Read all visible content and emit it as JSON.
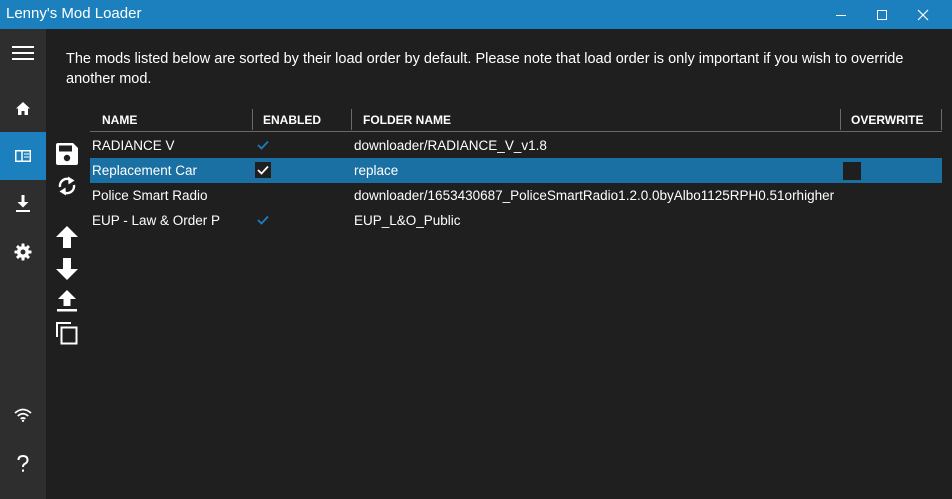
{
  "window": {
    "title": "Lenny's Mod Loader"
  },
  "sidebar": {
    "items": [
      {
        "icon": "hamburger-menu-icon"
      },
      {
        "icon": "home-icon"
      },
      {
        "icon": "mods-list-icon",
        "active": true
      },
      {
        "icon": "download-icon"
      },
      {
        "icon": "gear-icon"
      },
      {
        "icon": "wifi-icon"
      },
      {
        "icon": "help-icon"
      }
    ]
  },
  "intro": {
    "text": "The mods listed below are sorted by their load order by default. Please note that load order is only important if you wish to override another mod."
  },
  "toolbar": {
    "icons": [
      "save-icon",
      "refresh-icon",
      "move-up-icon",
      "move-down-icon",
      "move-to-top-icon",
      "copy-icon"
    ]
  },
  "grid": {
    "columns": [
      "NAME",
      "ENABLED",
      "FOLDER NAME",
      "OVERWRITE"
    ],
    "rows": [
      {
        "name": "RADIANCE V",
        "enabled": true,
        "folder": "downloader/RADIANCE_V_v1.8",
        "overwrite": false,
        "selected": false
      },
      {
        "name": "Replacement Car",
        "enabled": true,
        "folder": "replace",
        "overwrite": false,
        "selected": true
      },
      {
        "name": "Police Smart Radio",
        "enabled": false,
        "folder": "downloader/1653430687_PoliceSmartRadio1.2.0.0byAlbo1125RPH0.51orhigher",
        "overwrite": false,
        "selected": false
      },
      {
        "name": "EUP - Law & Order P",
        "enabled": true,
        "folder": "EUP_L&O_Public",
        "overwrite": false,
        "selected": false
      }
    ]
  },
  "colors": {
    "accent": "#1b80bd",
    "selected_row": "#1a6fa3",
    "background": "#1f1f1f",
    "sidebar": "#2e2e2e"
  }
}
